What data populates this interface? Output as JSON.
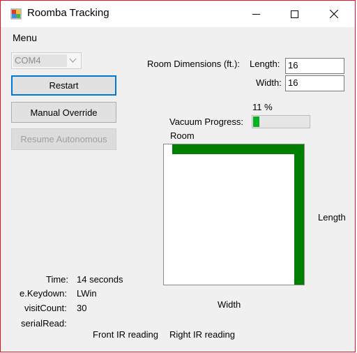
{
  "window": {
    "title": "Roomba Tracking"
  },
  "menu": {
    "items": [
      "Menu"
    ]
  },
  "com_port": {
    "selected": "COM4"
  },
  "buttons": {
    "restart": "Restart",
    "manual_override": "Manual Override",
    "resume_autonomous": "Resume Autonomous"
  },
  "room_dimensions": {
    "label": "Room Dimensions (ft.):",
    "length_label": "Length:",
    "length_value": "16",
    "width_label": "Width:",
    "width_value": "16"
  },
  "progress": {
    "percent_text": "11 %",
    "label": "Vacuum Progress:",
    "value": 0.11
  },
  "room": {
    "label": "Room",
    "length_label": "Length",
    "width_label": "Width",
    "wall_color": "#007f00"
  },
  "status": {
    "time_label": "Time:",
    "time_value": "14 seconds",
    "keydown_label": "e.Keydown:",
    "keydown_value": "LWin",
    "visit_label": "visitCount:",
    "visit_value": "30",
    "serial_label": "serialRead:",
    "serial_value": ""
  },
  "ir": {
    "front": "Front IR reading",
    "right": "Right IR reading"
  }
}
